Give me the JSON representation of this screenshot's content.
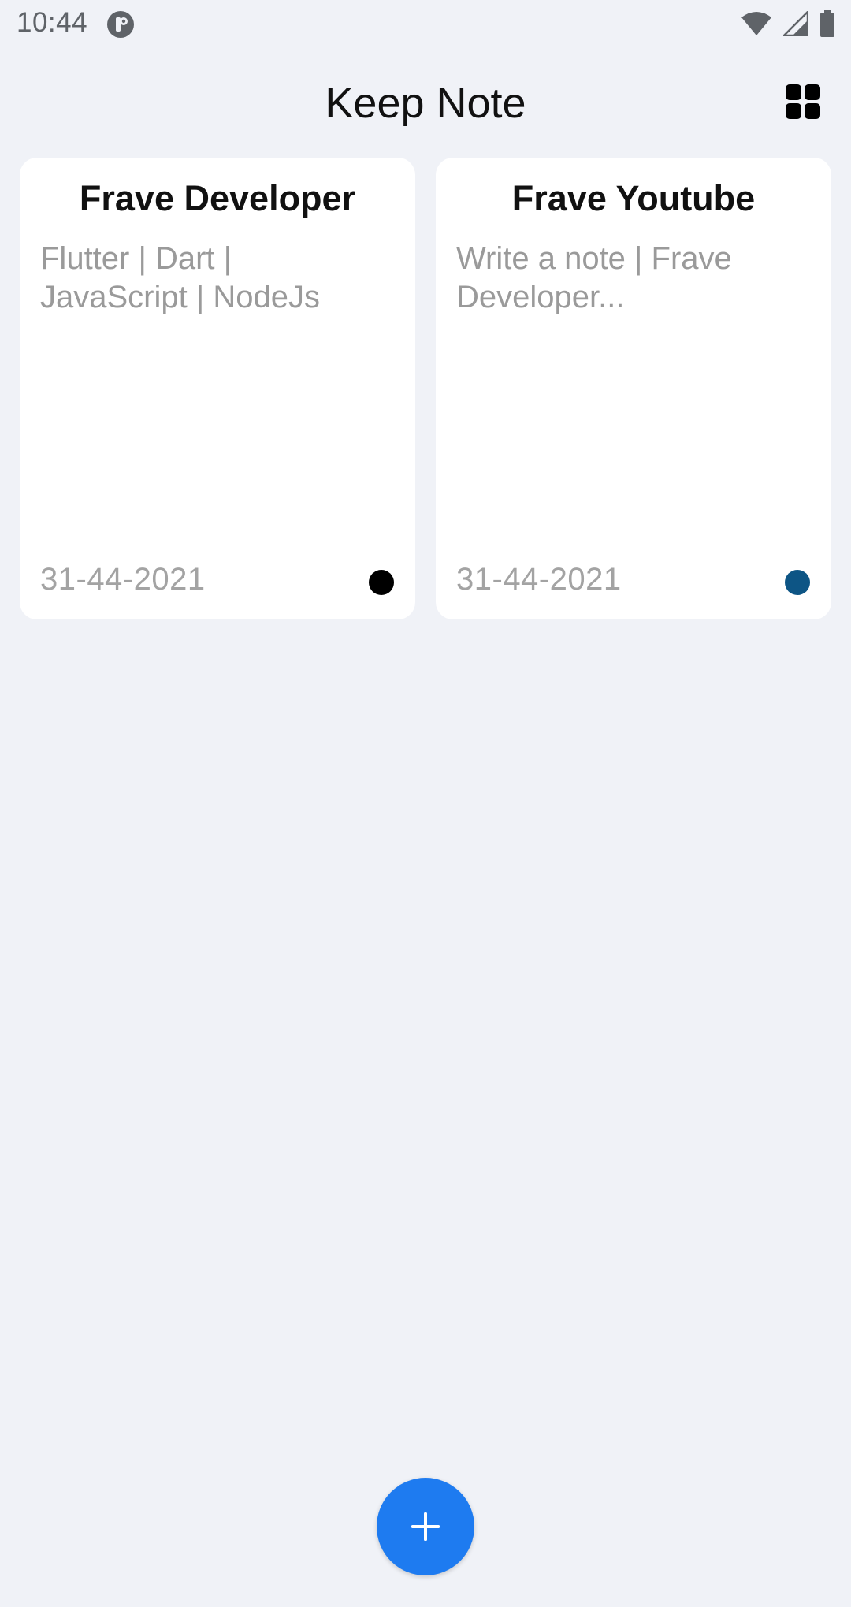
{
  "status_bar": {
    "time": "10:44"
  },
  "app_bar": {
    "title": "Keep Note"
  },
  "notes": [
    {
      "title": "Frave Developer",
      "body_lines": [
        "Flutter | Dart |",
        "JavaScript | NodeJs"
      ],
      "date": "31-44-2021",
      "color": "#000000"
    },
    {
      "title": "Frave Youtube",
      "body_lines": [
        "Write a note | Frave",
        "Developer..."
      ],
      "date": "31-44-2021",
      "color": "#0d5585"
    }
  ],
  "fab": {
    "icon": "plus-icon",
    "color": "#1e7bf0"
  },
  "icons": {
    "grid_view": "grid-view-icon",
    "wifi": "wifi-icon",
    "signal": "signal-icon",
    "battery": "battery-icon",
    "app_notification": "app-notification-icon"
  },
  "colors": {
    "background": "#F0F2F7",
    "card": "#ffffff",
    "muted_text": "#9a9a9a"
  }
}
